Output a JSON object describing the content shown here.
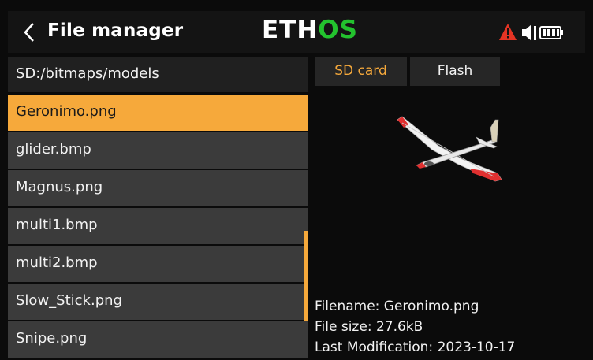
{
  "header": {
    "title": "File manager",
    "logo_part1": "ETH",
    "logo_part2": "OS",
    "logo_accent": "#23c22e",
    "status_icons": [
      "warning-icon",
      "speaker-icon",
      "battery-icon"
    ]
  },
  "accent_color": "#f6a93b",
  "path": "SD:/bitmaps/models",
  "files": [
    {
      "name": "Geronimo.png",
      "selected": true
    },
    {
      "name": "glider.bmp",
      "selected": false
    },
    {
      "name": "Magnus.png",
      "selected": false
    },
    {
      "name": "multi1.bmp",
      "selected": false
    },
    {
      "name": "multi2.bmp",
      "selected": false
    },
    {
      "name": "Slow_Stick.png",
      "selected": false
    },
    {
      "name": "Snipe.png",
      "selected": false
    }
  ],
  "tabs": {
    "sd": "SD card",
    "flash": "Flash",
    "active": "sd"
  },
  "info": {
    "filename": "Filename: Geronimo.png",
    "filesize": "File size: 27.6kB",
    "modified": "Last Modification: 2023-10-17"
  }
}
